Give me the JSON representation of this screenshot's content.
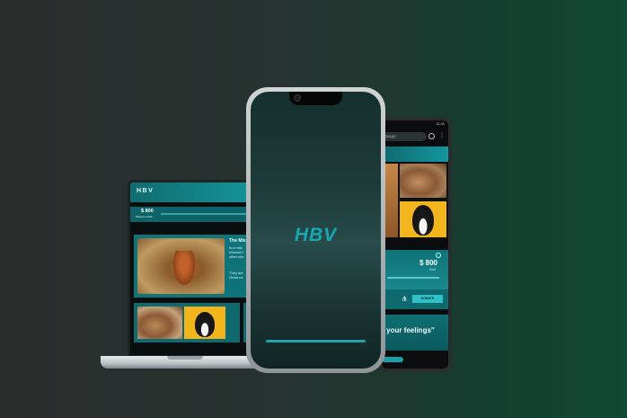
{
  "brand": {
    "logo_text": "HBV",
    "splash_text": "HBV"
  },
  "laptop": {
    "header_logo": "HBV",
    "amount": "$ 800",
    "amount_caption": "Raised of 900",
    "feature_title": "The Mis",
    "feature_text": "is a mist\nrefused t\noften mis",
    "feature_text_2": "They are\nGreat co"
  },
  "android": {
    "status_time": "11:11",
    "url_text": "epage",
    "amount": "$ 800",
    "amount_caption": "Sold",
    "donate_label": "DONATE",
    "quote_text": "ell your feelings\""
  },
  "colors": {
    "accent": "#17a8b4",
    "header": "#0f6a6e"
  }
}
